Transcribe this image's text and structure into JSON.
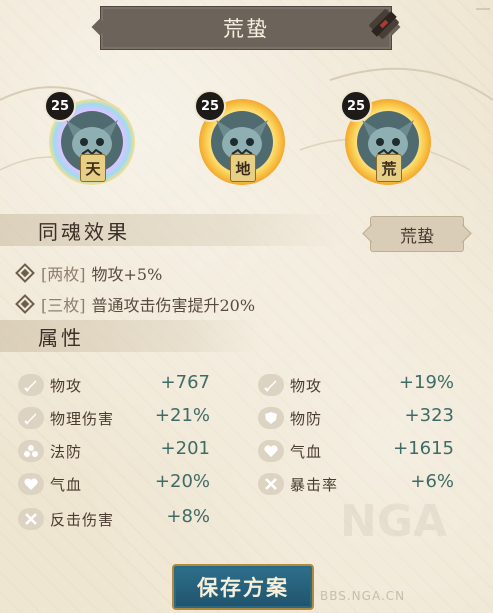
{
  "header": {
    "title": "荒蛰"
  },
  "souls": [
    {
      "level": "25",
      "position": "天"
    },
    {
      "level": "25",
      "position": "地"
    },
    {
      "level": "25",
      "position": "荒"
    }
  ],
  "set_effect": {
    "heading": "同魂效果",
    "tag": "荒蛰",
    "effects": [
      {
        "prefix": "[两枚]",
        "text": "物攻+5%"
      },
      {
        "prefix": "[三枚]",
        "text": "普通攻击伤害提升20%"
      }
    ]
  },
  "attributes": {
    "heading": "属性",
    "left": [
      {
        "label": "物攻",
        "value": "+767",
        "icon": "sword-icon"
      },
      {
        "label": "物理伤害",
        "value": "+21%",
        "icon": "sword-icon"
      },
      {
        "label": "法防",
        "value": "+201",
        "icon": "orbs-icon"
      },
      {
        "label": "气血",
        "value": "+20%",
        "icon": "heart-icon"
      },
      {
        "label": "反击伤害",
        "value": "+8%",
        "icon": "counter-icon"
      }
    ],
    "right": [
      {
        "label": "物攻",
        "value": "+19%",
        "icon": "sword-icon"
      },
      {
        "label": "物防",
        "value": "+323",
        "icon": "shield-icon"
      },
      {
        "label": "气血",
        "value": "+1615",
        "icon": "heart-icon"
      },
      {
        "label": "暴击率",
        "value": "+6%",
        "icon": "crit-icon"
      }
    ]
  },
  "footer": {
    "save_label": "保存方案"
  },
  "watermark": {
    "text": "NGA",
    "url": "BBS.NGA.CN"
  },
  "colors": {
    "value_teal": "#3f6b66",
    "banner": "#6c635a",
    "save_button": "#2f6f8b"
  }
}
